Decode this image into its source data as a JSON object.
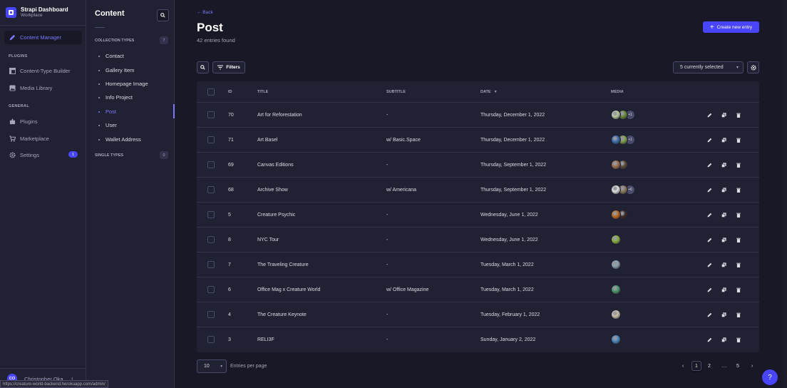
{
  "brand": {
    "title": "Strapi Dashboard",
    "subtitle": "Workplace"
  },
  "nav": {
    "active": "Content Manager",
    "plugins_heading": "PLUGINS",
    "plugins": [
      "Content-Type Builder",
      "Media Library"
    ],
    "general_heading": "GENERAL",
    "general": [
      "Plugins",
      "Marketplace",
      "Settings"
    ],
    "settings_badge": "1",
    "user_initials": "CO",
    "user_name": "Christopher Oka"
  },
  "sub": {
    "title": "Content",
    "collection_heading": "COLLECTION TYPES",
    "collection_count": "7",
    "collection_items": [
      "Contact",
      "Gallery Item",
      "Homepage Image",
      "Info Project",
      "Post",
      "User",
      "Wallet Address"
    ],
    "active_item": "Post",
    "single_heading": "SINGLE TYPES",
    "single_count": "0"
  },
  "main": {
    "back": "← Back",
    "title": "Post",
    "count": "42 entries found",
    "create_label": "Create new entry",
    "filters_label": "Filters",
    "columns_selected": "5 currently selected"
  },
  "table": {
    "headers": {
      "id": "ID",
      "title": "TITLE",
      "subtitle": "SUBTITLE",
      "date": "DATE",
      "media": "MEDIA"
    },
    "rows": [
      {
        "id": "70",
        "title": "Art for Reforestation",
        "subtitle": "-",
        "date": "Thursday, December 1, 2022",
        "media_more": "+1",
        "media_colors": [
          "#b8c9a0",
          "#6b8a3a"
        ]
      },
      {
        "id": "71",
        "title": "Art Basel",
        "subtitle": "w/ Basic.Space",
        "date": "Thursday, December 1, 2022",
        "media_more": "+1",
        "media_colors": [
          "#3d6fb0",
          "#7fa04a"
        ]
      },
      {
        "id": "69",
        "title": "Canvas Editions",
        "subtitle": "-",
        "date": "Thursday, September 1, 2022",
        "media_more": "",
        "media_colors": [
          "#a07050",
          "#5a4a3a"
        ]
      },
      {
        "id": "68",
        "title": "Archive Show",
        "subtitle": "w/ Americana",
        "date": "Thursday, September 1, 2022",
        "media_more": "+6",
        "media_colors": [
          "#e0e0e0",
          "#8a7a5a"
        ]
      },
      {
        "id": "5",
        "title": "Creature Psychic",
        "subtitle": "-",
        "date": "Wednesday, June 1, 2022",
        "media_more": "",
        "media_colors": [
          "#c06a20",
          "#3a2a2a"
        ]
      },
      {
        "id": "8",
        "title": "NYC Tour",
        "subtitle": "-",
        "date": "Wednesday, June 1, 2022",
        "media_more": "",
        "media_colors": [
          "#8ab040"
        ]
      },
      {
        "id": "7",
        "title": "The Traveling Creature",
        "subtitle": "-",
        "date": "Tuesday, March 1, 2022",
        "media_more": "",
        "media_colors": [
          "#8aa0b0"
        ]
      },
      {
        "id": "6",
        "title": "Office Mag x Creature World",
        "subtitle": "w/ Office Magazine",
        "date": "Tuesday, March 1, 2022",
        "media_more": "",
        "media_colors": [
          "#4a9a6a"
        ]
      },
      {
        "id": "4",
        "title": "The Creature Keynote",
        "subtitle": "-",
        "date": "Tuesday, February 1, 2022",
        "media_more": "",
        "media_colors": [
          "#c8c0a8"
        ]
      },
      {
        "id": "3",
        "title": "RELI3F",
        "subtitle": "-",
        "date": "Sunday, January 2, 2022",
        "media_more": "",
        "media_colors": [
          "#4a8ac0"
        ]
      }
    ]
  },
  "pagination": {
    "per_page": "10",
    "per_page_label": "Entries per page",
    "pages": [
      "1",
      "2",
      "…",
      "5"
    ],
    "current": "1"
  },
  "status_url": "https://creature-world-backend.herokuapp.com/admin/",
  "help": "?",
  "colors": {
    "accent": "#4945ff",
    "accent_text": "#7b79ff",
    "bg": "#181826",
    "panel": "#212134"
  }
}
